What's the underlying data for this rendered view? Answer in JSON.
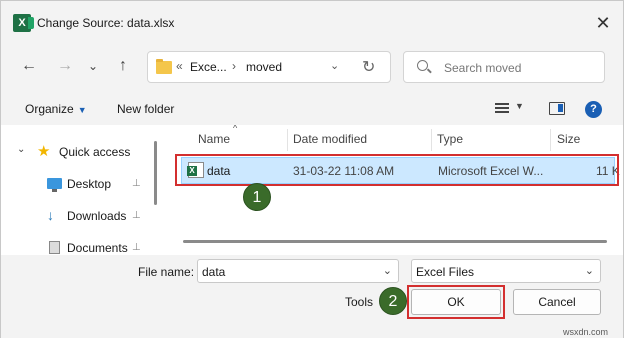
{
  "window": {
    "title": "Change Source: data.xlsx",
    "close_glyph": "✕"
  },
  "nav": {
    "back_glyph": "←",
    "forward_glyph": "→",
    "recent_glyph": "⌄",
    "up_glyph": "↑",
    "address": {
      "chevrons": "«",
      "part1": "Exce...",
      "sep": "›",
      "part2": "moved",
      "dropdown_glyph": "⌄",
      "refresh_glyph": "↻"
    },
    "search_placeholder": "Search moved"
  },
  "commands": {
    "organize": "Organize",
    "organize_caret": "▼",
    "new_folder": "New folder",
    "view_caret": "▼",
    "help": "?"
  },
  "sidebar": {
    "items": [
      {
        "label": "Quick access",
        "chevron": "⌄",
        "icon": "star-icon"
      },
      {
        "label": "Desktop",
        "icon": "desktop-icon",
        "pinned": true
      },
      {
        "label": "Downloads",
        "icon": "download-icon",
        "pinned": true
      },
      {
        "label": "Documents",
        "icon": "documents-icon",
        "pinned": true
      }
    ],
    "star_glyph": "★",
    "pin_glyph": "📌",
    "download_glyph": "↓"
  },
  "columns": {
    "name": "Name",
    "sort": "^",
    "date_modified": "Date modified",
    "type": "Type",
    "size": "Size"
  },
  "files": [
    {
      "name": "data",
      "date_modified": "31-03-22 11:08 AM",
      "type": "Microsoft Excel W...",
      "size": "11 K"
    }
  ],
  "footer": {
    "file_name_label": "File name:",
    "file_name_value": "data",
    "file_name_dd": "⌄",
    "file_type": "Excel Files",
    "file_type_dd": "⌄",
    "tools": "Tools",
    "ok": "OK",
    "cancel": "Cancel"
  },
  "annotations": {
    "step1": "1",
    "step2": "2"
  },
  "watermark": "wsxdn.com",
  "colors": {
    "selection": "#cce8ff",
    "highlight": "#d32f2f",
    "badge": "#3a6b2a",
    "excel_green": "#1e7145"
  }
}
